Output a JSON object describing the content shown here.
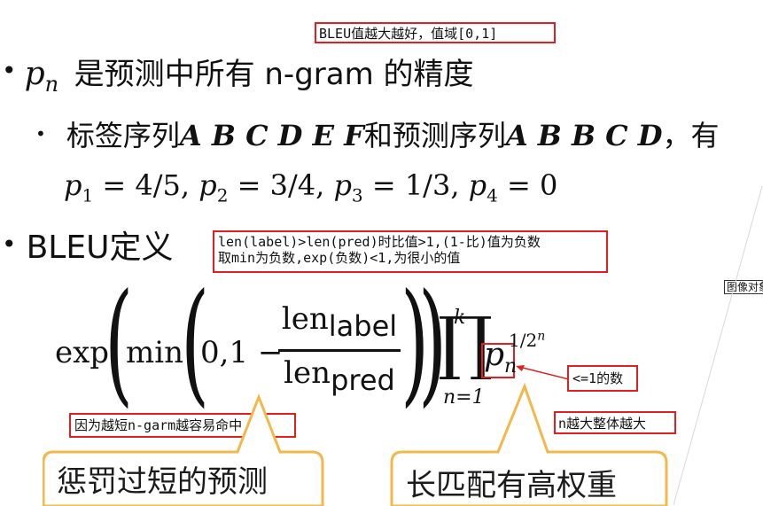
{
  "annotations": {
    "bleu_range": "BLEU值越大越好，值域[0,1]",
    "penalty_note_line1": "len(label)>len(pred)时比值>1,(1-比)值为负数",
    "penalty_note_line2": "取min为负数,exp(负数)<1,为很小的值",
    "short_ngram_note": "因为越短n-garm越容易命中",
    "pn_note": "<=1的数",
    "n_weight_note": "n越大整体越大",
    "side_tag": "图像对象"
  },
  "bullets": {
    "pn_symbol": "p",
    "pn_sub": "n",
    "pn_text": "是预测中所有 n-gram 的精度",
    "example_prefix": "标签序列",
    "label_seq": "A B C D E F",
    "example_mid": "和预测序列",
    "pred_seq": "A B B C D",
    "example_suffix": "，有",
    "p_values": [
      {
        "sym": "p",
        "sub": "1",
        "val": "= 4/5,"
      },
      {
        "sym": "p",
        "sub": "2",
        "val": "= 3/4,"
      },
      {
        "sym": "p",
        "sub": "3",
        "val": "= 1/3,"
      },
      {
        "sym": "p",
        "sub": "4",
        "val": "= 0"
      }
    ],
    "bleu_def": "BLEU定义"
  },
  "formula": {
    "exp": "exp",
    "min": "min",
    "zero_one": "0,1 −",
    "len_top": "len",
    "label_sub": "label",
    "len_bottom": "len",
    "pred_sub": "pred",
    "prod_upper": "k",
    "prod_lower": "n=1",
    "pn": "p",
    "pn_sub": "n",
    "exponent": "1/2",
    "exponent_sup": "n"
  },
  "callouts": {
    "penalize_short": "惩罚过短的预测",
    "long_match_weight": "长匹配有高权重"
  },
  "colors": {
    "red": "#e02020",
    "callout_border": "#f2b84b"
  }
}
